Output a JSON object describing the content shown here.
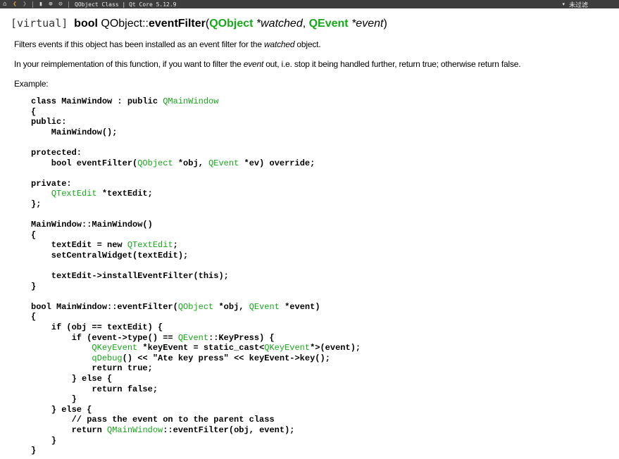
{
  "toolbar": {
    "icons": [
      "home-icon",
      "back-icon",
      "forward-icon",
      "bookmark-icon",
      "globe-icon",
      "link-icon"
    ],
    "home_glyph": "⌂",
    "back_glyph": "❮",
    "forward_glyph": "❯",
    "bookmark_glyph": "▮",
    "globe_glyph": "⊕",
    "link_glyph": "⊝",
    "title": "QObject Class | Qt Core 5.12.9",
    "filter_caret": "▾",
    "filter_label": "未过滤",
    "colors": {
      "background": "#3d3d3d",
      "back_accent": "#e8a33a"
    }
  },
  "doc": {
    "signature": {
      "virtual": "[virtual]",
      "return_type": "bool",
      "class_prefix": "QObject::",
      "method": "eventFilter",
      "open_paren": "(",
      "param1_type": "QObject",
      "param1_name": " *watched",
      "comma": ", ",
      "param2_type": "QEvent",
      "param2_name": " *event",
      "close_paren": ")"
    },
    "para1": {
      "t1": "Filters events if this object has been installed as an event filter for the ",
      "em": "watched",
      "t2": " object."
    },
    "para2": {
      "t1": "In your reimplementation of this function, if you want to filter the ",
      "em": "event",
      "t2": " out, i.e. stop it being handled further, return true; otherwise return false."
    },
    "example_label": "Example:",
    "code": {
      "l1a": "class MainWindow : public ",
      "l1b": "QMainWindow",
      "l2": "{",
      "l3": "public:",
      "l4": "    MainWindow();",
      "l6": "protected:",
      "l7a": "    bool eventFilter(",
      "l7b": "QObject",
      "l7c": " *obj, ",
      "l7d": "QEvent",
      "l7e": " *ev) override;",
      "l9": "private:",
      "l10a": "    ",
      "l10b": "QTextEdit",
      "l10c": " *textEdit;",
      "l11": "};",
      "l13": "MainWindow::MainWindow()",
      "l14": "{",
      "l15a": "    textEdit = new ",
      "l15b": "QTextEdit",
      "l15c": ";",
      "l16": "    setCentralWidget(textEdit);",
      "l18": "    textEdit->installEventFilter(this);",
      "l19": "}",
      "l21a": "bool MainWindow::eventFilter(",
      "l21b": "QObject",
      "l21c": " *obj, ",
      "l21d": "QEvent",
      "l21e": " *event)",
      "l22": "{",
      "l23": "    if (obj == textEdit) {",
      "l24a": "        if (event->type() == ",
      "l24b": "QEvent",
      "l24c": "::KeyPress) {",
      "l25a": "            ",
      "l25b": "QKeyEvent",
      "l25c": " *keyEvent = static_cast<",
      "l25d": "QKeyEvent",
      "l25e": "*>(event);",
      "l26a": "            ",
      "l26b": "qDebug",
      "l26c": "() << \"Ate key press\" << keyEvent->key();",
      "l27": "            return true;",
      "l28": "        } else {",
      "l29": "            return false;",
      "l30": "        }",
      "l31": "    } else {",
      "l32": "        // pass the event on to the parent class",
      "l33a": "        return ",
      "l33b": "QMainWindow",
      "l33c": "::eventFilter(obj, event);",
      "l34": "    }",
      "l35": "}"
    },
    "colors": {
      "type_link": "#17a81a",
      "code_link": "#4aa82b",
      "text": "#000000"
    }
  }
}
